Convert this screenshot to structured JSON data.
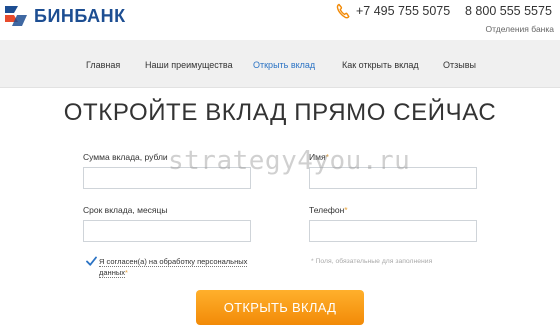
{
  "header": {
    "logo_text": "БИНБАНК",
    "phones": [
      "+7 495 755 5075",
      "8 800 555 5575"
    ],
    "branches_label": "Отделения банка"
  },
  "nav": {
    "items": [
      {
        "label": "Главная"
      },
      {
        "label": "Наши преимущества"
      },
      {
        "label": "Открыть вклад",
        "active": true
      },
      {
        "label": "Как открыть вклад"
      },
      {
        "label": "Отзывы"
      }
    ]
  },
  "main": {
    "title": "ОТКРОЙТЕ ВКЛАД ПРЯМО СЕЙЧАС",
    "fields": {
      "amount": {
        "label": "Сумма вклада, рубли",
        "value": ""
      },
      "name": {
        "label": "Имя",
        "required_mark": "*",
        "value": ""
      },
      "term": {
        "label": "Срок вклада, месяцы",
        "value": ""
      },
      "phone": {
        "label": "Телефон",
        "required_mark": "*",
        "value": ""
      }
    },
    "consent": {
      "label": "Я согласен(а) на обработку персональных данных",
      "required_mark": "*",
      "checked": true
    },
    "required_note": "* Поля, обязательные для заполнения",
    "submit_label": "ОТКРЫТЬ ВКЛАД"
  },
  "watermark": "strategy4you.ru",
  "colors": {
    "brand_blue": "#1d4e92",
    "nav_active": "#2b73c4",
    "accent_orange": "#f28a07",
    "required_star": "#e8a33a"
  },
  "icons": {
    "phone": "phone-icon",
    "checkbox": "checkmark-icon"
  }
}
